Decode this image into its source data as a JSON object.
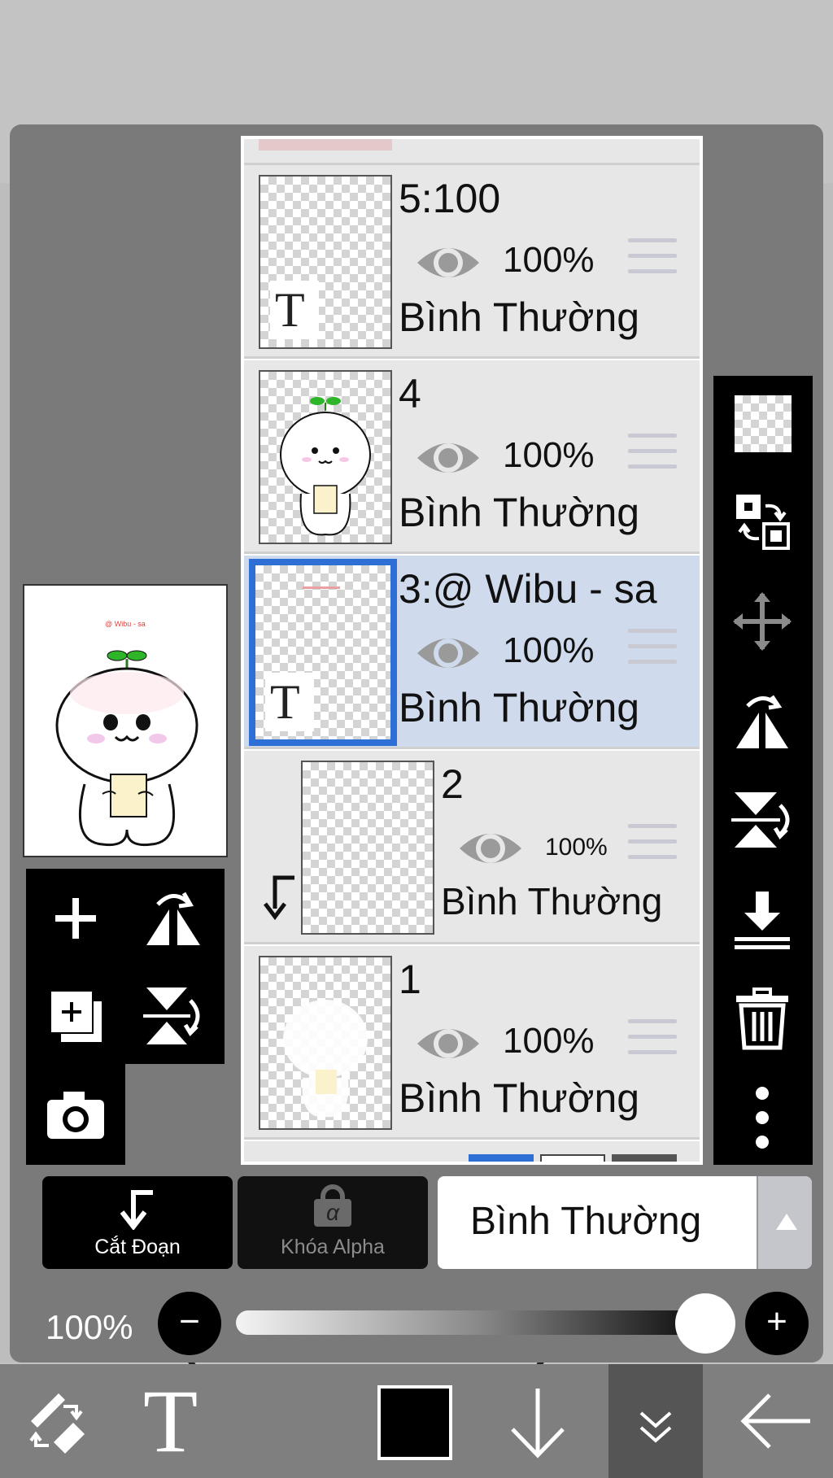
{
  "layers": [
    {
      "name": "5:100",
      "opacity": "100%",
      "blend": "Bình Thường",
      "has_text": true,
      "selected": false
    },
    {
      "name": "4",
      "opacity": "100%",
      "blend": "Bình Thường",
      "has_text": false,
      "selected": false
    },
    {
      "name": "3:@ Wibu - sa",
      "opacity": "100%",
      "blend": "Bình Thường",
      "has_text": true,
      "selected": true
    },
    {
      "name": "2",
      "opacity": "100%",
      "blend": "Bình Thường",
      "has_text": false,
      "selected": false,
      "clipped": true
    },
    {
      "name": "1",
      "opacity": "100%",
      "blend": "Bình Thường",
      "has_text": false,
      "selected": false
    }
  ],
  "text_glyph": "T",
  "buttons": {
    "clip_label": "Cắt Đoạn",
    "alpha_lock_label": "Khóa Alpha",
    "alpha_symbol": "α"
  },
  "blend_mode_select": {
    "value": "Bình Thường"
  },
  "opacity_slider": {
    "label": "100%",
    "value_fraction": 1.0,
    "minus": "−",
    "plus": "+"
  },
  "bottom_toolbar": {
    "text_tool": "T",
    "current_color": "#000000"
  },
  "preview_caption": "@ Wibu - sa"
}
